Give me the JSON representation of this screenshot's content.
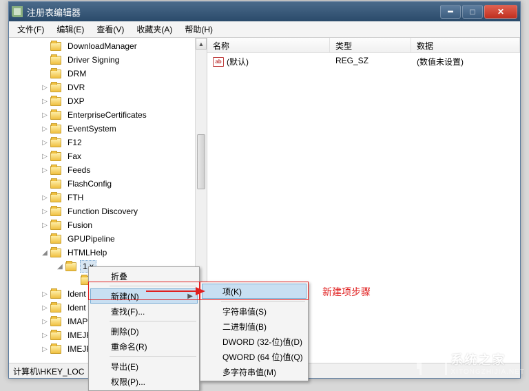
{
  "window": {
    "title": "注册表编辑器"
  },
  "menu": {
    "file": "文件(F)",
    "edit": "编辑(E)",
    "view": "查看(V)",
    "fav": "收藏夹(A)",
    "help": "帮助(H)"
  },
  "tree": {
    "items": [
      {
        "toggle": "",
        "label": "DownloadManager",
        "level": 1
      },
      {
        "toggle": "",
        "label": "Driver Signing",
        "level": 1
      },
      {
        "toggle": "",
        "label": "DRM",
        "level": 1
      },
      {
        "toggle": "▷",
        "label": "DVR",
        "level": 1
      },
      {
        "toggle": "▷",
        "label": "DXP",
        "level": 1
      },
      {
        "toggle": "▷",
        "label": "EnterpriseCertificates",
        "level": 1
      },
      {
        "toggle": "▷",
        "label": "EventSystem",
        "level": 1
      },
      {
        "toggle": "▷",
        "label": "F12",
        "level": 1
      },
      {
        "toggle": "▷",
        "label": "Fax",
        "level": 1
      },
      {
        "toggle": "▷",
        "label": "Feeds",
        "level": 1
      },
      {
        "toggle": "",
        "label": "FlashConfig",
        "level": 1
      },
      {
        "toggle": "▷",
        "label": "FTH",
        "level": 1
      },
      {
        "toggle": "▷",
        "label": "Function Discovery",
        "level": 1
      },
      {
        "toggle": "▷",
        "label": "Fusion",
        "level": 1
      },
      {
        "toggle": "",
        "label": "GPUPipeline",
        "level": 1
      },
      {
        "toggle": "◢",
        "label": "HTMLHelp",
        "level": 1
      },
      {
        "toggle": "◢",
        "label": "1.x",
        "level": 2,
        "selected": true
      },
      {
        "toggle": "",
        "label": "",
        "level": 3,
        "selected": false
      },
      {
        "toggle": "▷",
        "label": "Ident",
        "level": 1
      },
      {
        "toggle": "▷",
        "label": "Ident",
        "level": 1
      },
      {
        "toggle": "▷",
        "label": "IMAP",
        "level": 1
      },
      {
        "toggle": "▷",
        "label": "IMEJF",
        "level": 1
      },
      {
        "toggle": "▷",
        "label": "IMEJF",
        "level": 1
      }
    ]
  },
  "columns": {
    "name": "名称",
    "type": "类型",
    "data": "数据"
  },
  "row": {
    "name": "(默认)",
    "type": "REG_SZ",
    "data": "(数值未设置)"
  },
  "ctx1": {
    "collapse": "折叠",
    "new": "新建(N)",
    "find": "查找(F)...",
    "delete": "删除(D)",
    "rename": "重命名(R)",
    "export": "导出(E)",
    "perm": "权限(P)..."
  },
  "ctx2": {
    "key": "项(K)",
    "string": "字符串值(S)",
    "binary": "二进制值(B)",
    "dword": "DWORD (32-位)值(D)",
    "qword": "QWORD (64 位)值(Q)",
    "multi": "多字符串值(M)"
  },
  "annotation": "新建项步骤",
  "status": "计算机\\HKEY_LOC",
  "watermark": {
    "brand": "系统之家",
    "url": "XITONGZHIJIA.NET"
  }
}
